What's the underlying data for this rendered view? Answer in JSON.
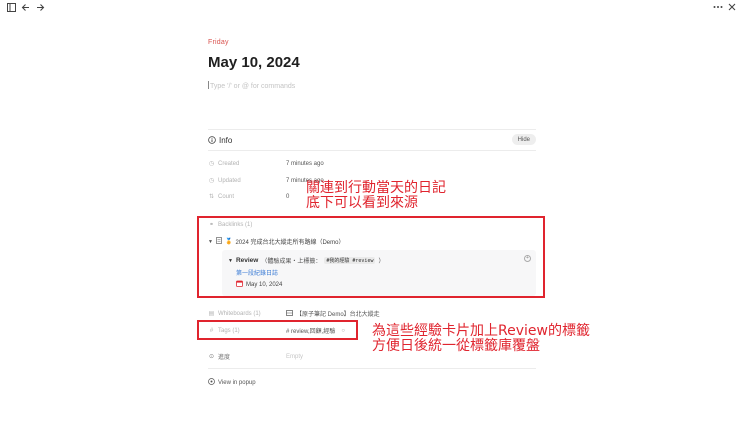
{
  "topbar": {
    "left_icons": [
      "sidebar-toggle-icon",
      "back-arrow-icon",
      "forward-arrow-icon"
    ],
    "right_icons": [
      "more-icon",
      "close-icon"
    ]
  },
  "page": {
    "weekday": "Friday",
    "title": "May 10, 2024",
    "comment_placeholder": "Type '/' or @ for commands"
  },
  "info": {
    "title": "Info",
    "hide_label": "Hide",
    "properties": {
      "created": {
        "label": "Created",
        "value": "7 minutes ago"
      },
      "updated": {
        "label": "Updated",
        "value": "7 minutes ago"
      },
      "count": {
        "label": "Count",
        "value": "0"
      }
    },
    "backlinks": {
      "label": "Backlinks (1)",
      "item": {
        "emoji": "🏅",
        "title": "2024 完成台北大縱走所有路線（Demo）"
      },
      "card": {
        "review_label": "Review",
        "review_detail_prefix": "（體驗成果・上標籤：",
        "review_detail_tag": "#我的經驗 #review",
        "review_detail_suffix": "）",
        "link_text": "第一段紀錄日誌",
        "date": "May 10, 2024"
      }
    },
    "whiteboards": {
      "label": "Whiteboards (1)",
      "value": "【原子筆記 Demo】台北大縱走"
    },
    "tags": {
      "label": "Tags (1)",
      "value": "# review,回顧,經驗",
      "marker": "○"
    },
    "progress": {
      "label": "進度",
      "value": "Empty"
    },
    "view_in_popup": "View in popup"
  },
  "annotations": {
    "backlinks_note": [
      "關連到行動當天的日記",
      "底下可以看到來源"
    ],
    "tags_note": [
      "為這些經驗卡片加上Review的標籤",
      "方便日後統一從標籤庫覆盤"
    ]
  },
  "colors": {
    "accent_red": "#e0242e",
    "weekday_red": "#d9534f",
    "link_blue": "#3a7bd5"
  }
}
